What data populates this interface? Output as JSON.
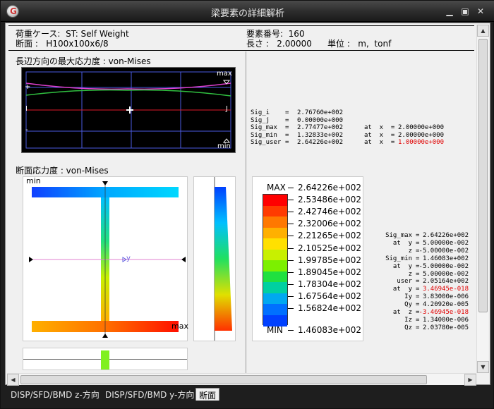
{
  "window": {
    "title": "梁要素の詳細解析"
  },
  "header": {
    "load_case": "荷重ケース:  ST: Self Weight",
    "section": "断面 :   H100x100x6/8",
    "element_no": "要素番号:  160",
    "length": "長さ :   2.00000",
    "unit": "単位 :   m,  tonf"
  },
  "longitudinal": {
    "title": "長辺方向の最大応力度 : von-Mises",
    "max_label": "max",
    "min_label": "min",
    "plus": "+",
    "minus": "-",
    "i_label": "I",
    "j_label": "J"
  },
  "section_stress": {
    "title": "断面応力度 : von-Mises",
    "min_label": "min",
    "max_label": "max",
    "y_label": "y"
  },
  "stress_summary": [
    {
      "name": "Sig_i",
      "value": "2.76760e+002"
    },
    {
      "name": "Sig_j",
      "value": "0.00000e+000"
    },
    {
      "name": "Sig_max",
      "value": "2.77477e+002",
      "at_label": "at  x  =",
      "at_value": "2.00000e+000",
      "red": false
    },
    {
      "name": "Sig_min",
      "value": "1.32833e+002",
      "at_label": "at  x  =",
      "at_value": "2.00000e+000",
      "red": false
    },
    {
      "name": "Sig_user",
      "value": "2.64226e+002",
      "at_label": "at  x  =",
      "at_value": "1.00000e+000",
      "red": true
    }
  ],
  "colorbar": {
    "max_caption": "MAX",
    "min_caption": "MIN",
    "labels": [
      "2.64226e+002",
      "2.53486e+002",
      "2.42746e+002",
      "2.32006e+002",
      "2.21265e+002",
      "2.10525e+002",
      "1.99785e+002",
      "1.89045e+002",
      "1.78304e+002",
      "1.67564e+002",
      "1.56824e+002",
      "1.46083e+002"
    ],
    "colors": [
      "#ff0000",
      "#ff3a00",
      "#ff7800",
      "#ffb000",
      "#ffe000",
      "#c8f000",
      "#7cf000",
      "#20e040",
      "#00d0a0",
      "#00a8f0",
      "#0070ff",
      "#0040ff"
    ]
  },
  "section_details": [
    {
      "label": "Sig_max",
      "eq": "=",
      "value": "2.64226e+002",
      "red": false
    },
    {
      "label": "at  y",
      "eq": "=",
      "value": "5.00000e-002",
      "red": false
    },
    {
      "label": "z",
      "eq": "=",
      "value": "-5.00000e-002",
      "red": false
    },
    {
      "label": "Sig_min",
      "eq": "=",
      "value": "1.46083e+002",
      "red": false
    },
    {
      "label": "at  y",
      "eq": "=",
      "value": "-5.00000e-002",
      "red": false
    },
    {
      "label": "z",
      "eq": "=",
      "value": "5.00000e-002",
      "red": false
    },
    {
      "label": "user",
      "eq": "=",
      "value": "2.05164e+002",
      "red": false
    },
    {
      "label": "at  y",
      "eq": "=",
      "value": "3.46945e-018",
      "red": true
    },
    {
      "label": "Iy",
      "eq": "=",
      "value": "3.83000e-006",
      "red": false
    },
    {
      "label": "Qy",
      "eq": "=",
      "value": "4.20920e-005",
      "red": false
    },
    {
      "label": "at  z",
      "eq": "=",
      "value": "-3.46945e-018",
      "red": true
    },
    {
      "label": "Iz",
      "eq": "=",
      "value": "1.34000e-006",
      "red": false
    },
    {
      "label": "Qz",
      "eq": "=",
      "value": "2.03780e-005",
      "red": false
    }
  ],
  "tabs": [
    {
      "label": "DISP/SFD/BMD z-方向",
      "active": false
    },
    {
      "label": "DISP/SFD/BMD y-方向",
      "active": false
    },
    {
      "label": "断面",
      "active": true
    }
  ],
  "icons": [
    "app-icon",
    "minimize-icon",
    "maximize-icon",
    "close-icon",
    "scroll-up-icon",
    "scroll-down-icon",
    "scroll-left-icon",
    "scroll-right-icon"
  ]
}
